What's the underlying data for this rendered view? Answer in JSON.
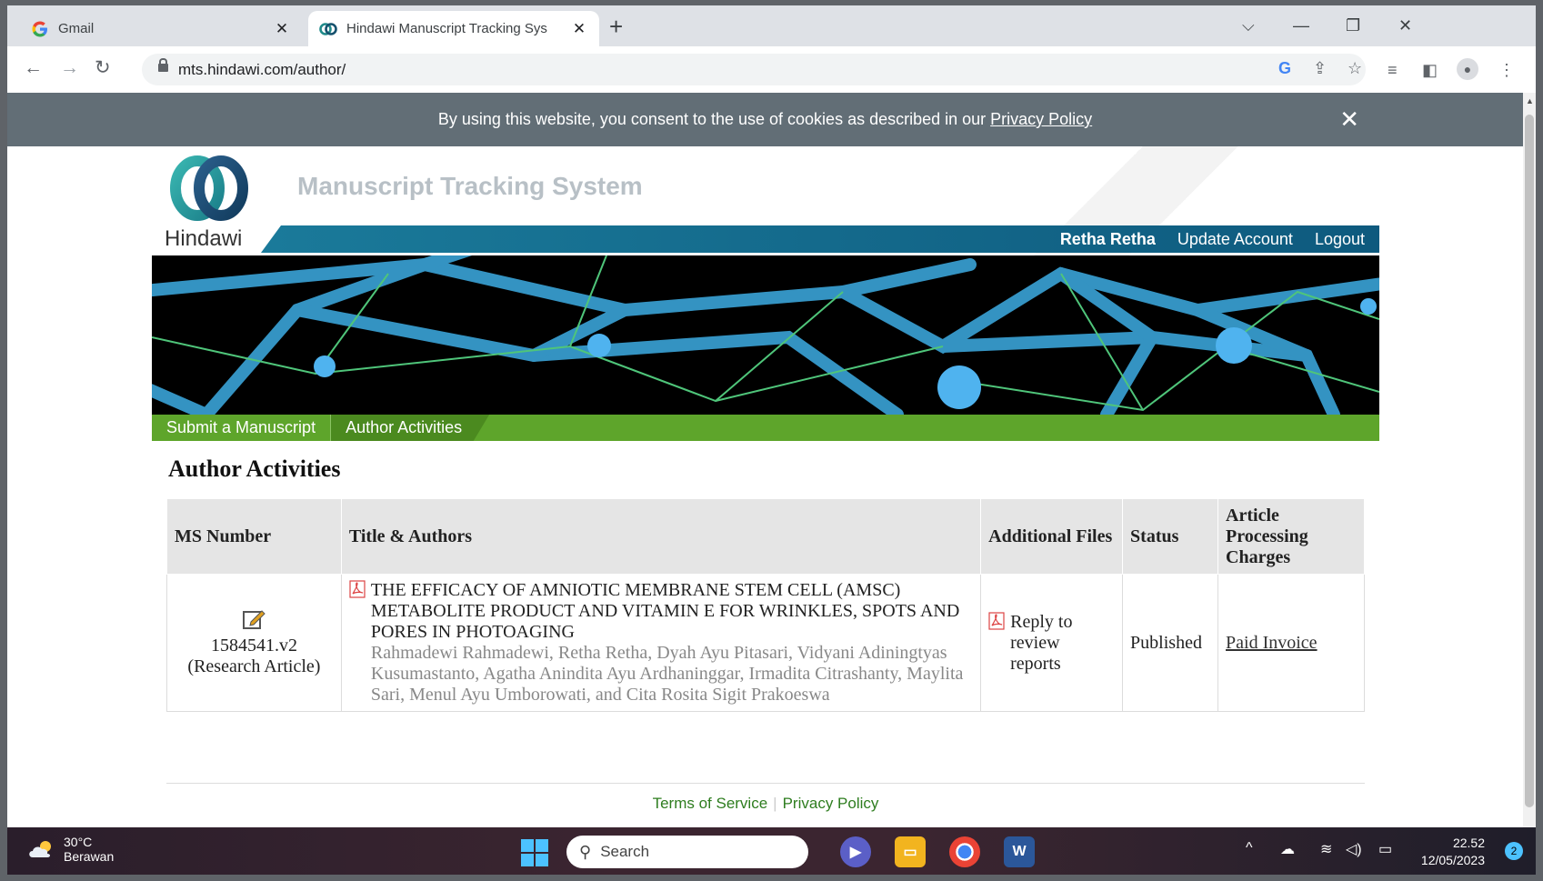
{
  "browser": {
    "tabs": [
      {
        "title": "Gmail",
        "icon": "google-icon"
      },
      {
        "title": "Hindawi Manuscript Tracking Sys",
        "icon": "hindawi-icon"
      }
    ],
    "url": "mts.hindawi.com/author/"
  },
  "cookie": {
    "text": "By using this website, you consent to the use of cookies as described in our ",
    "link": "Privacy Policy"
  },
  "header": {
    "brand": "Hindawi",
    "system_title": "Manuscript Tracking System",
    "user_name": "Retha Retha",
    "update_account": "Update Account",
    "logout": "Logout"
  },
  "nav": {
    "submit": "Submit a Manuscript",
    "activities": "Author Activities"
  },
  "main": {
    "heading": "Author Activities",
    "columns": [
      "MS Number",
      "Title & Authors",
      "Additional Files",
      "Status",
      "Article Processing Charges"
    ],
    "row": {
      "ms_number": "1584541.v2",
      "type": "(Research Article)",
      "title": "THE EFFICACY OF AMNIOTIC MEMBRANE STEM CELL (AMSC) METABOLITE PRODUCT AND VITAMIN E FOR WRINKLES, SPOTS AND PORES IN PHOTOAGING",
      "authors": "Rahmadewi Rahmadewi, Retha Retha, Dyah Ayu Pitasari, Vidyani Adiningtyas Kusumastanto, Agatha Anindita Ayu Ardhaninggar, Irmadita Citrashanty, Maylita Sari, Menul Ayu Umborowati, and Cita Rosita Sigit Prakoeswa",
      "additional_files": "Reply to review reports",
      "status": "Published",
      "apc": "Paid Invoice"
    }
  },
  "footer": {
    "terms": "Terms of Service",
    "privacy": "Privacy Policy"
  },
  "taskbar": {
    "temp": "30°C",
    "weather": "Berawan",
    "search": "Search",
    "time": "22.52",
    "date": "12/05/2023",
    "notifications": "2"
  }
}
